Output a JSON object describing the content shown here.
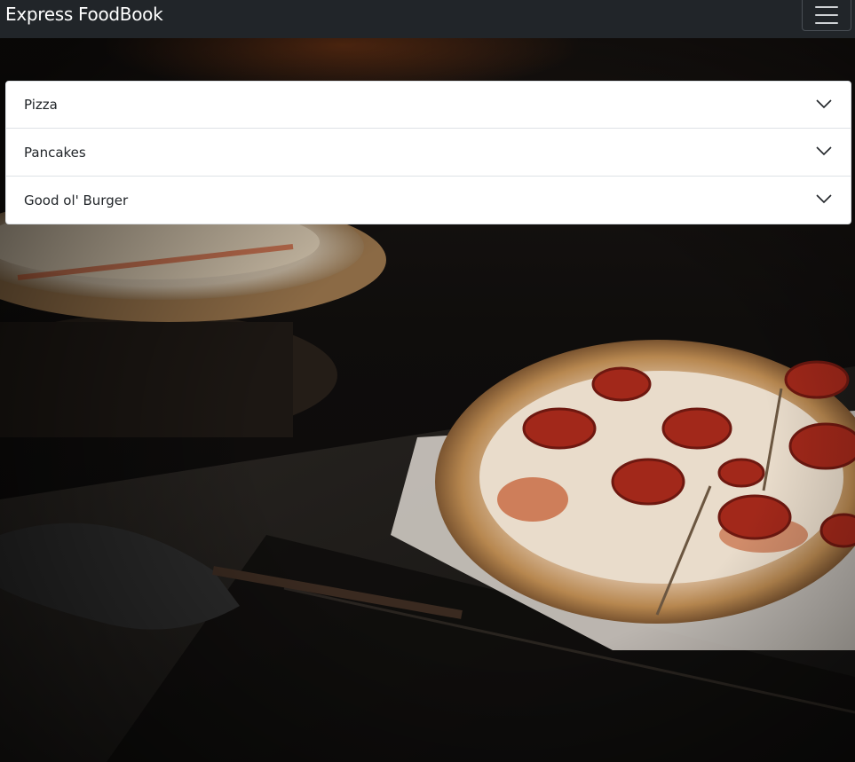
{
  "navbar": {
    "brand": "Express FoodBook",
    "toggler_icon": "hamburger-menu-icon"
  },
  "hero": {
    "image": "pizza-oven-background"
  },
  "accordion": {
    "items": [
      {
        "label": "Pizza",
        "icon": "chevron-down-icon"
      },
      {
        "label": "Pancakes",
        "icon": "chevron-down-icon"
      },
      {
        "label": "Good ol' Burger",
        "icon": "chevron-down-icon"
      }
    ]
  }
}
